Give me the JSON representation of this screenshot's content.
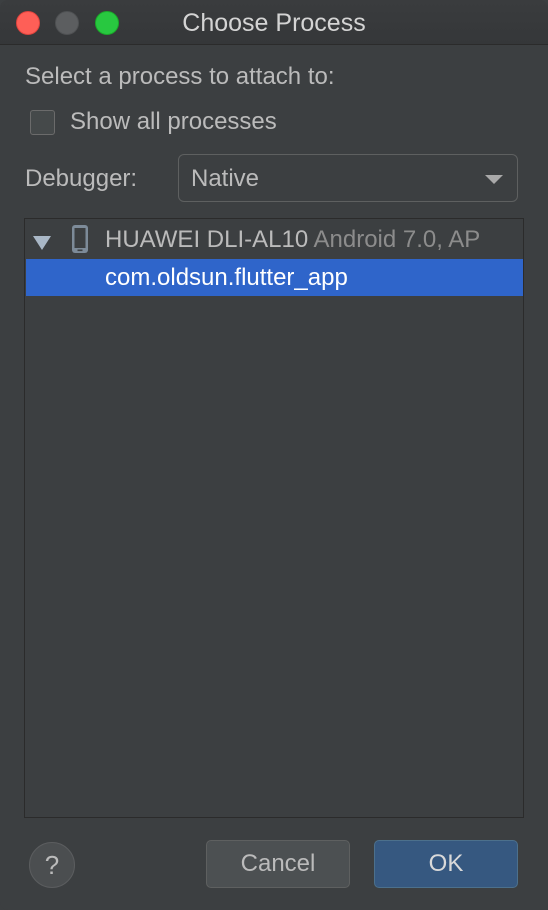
{
  "window": {
    "title": "Choose Process"
  },
  "dialog": {
    "prompt": "Select a process to attach to:",
    "show_all_label": "Show all processes",
    "show_all_checked": false,
    "debugger_label": "Debugger:",
    "debugger_value": "Native"
  },
  "tree": {
    "device": {
      "name": "HUAWEI DLI-AL10",
      "info": "Android 7.0, AP",
      "icon": "phone-icon",
      "expanded": true
    },
    "processes": [
      {
        "name": "com.oldsun.flutter_app",
        "selected": true
      }
    ]
  },
  "buttons": {
    "help_glyph": "?",
    "cancel_label": "Cancel",
    "ok_label": "OK"
  },
  "colors": {
    "background": "#3c3f41",
    "selection": "#2f65ca",
    "primary_button": "#365880",
    "close": "#fe5f57",
    "maximize": "#28c840"
  }
}
